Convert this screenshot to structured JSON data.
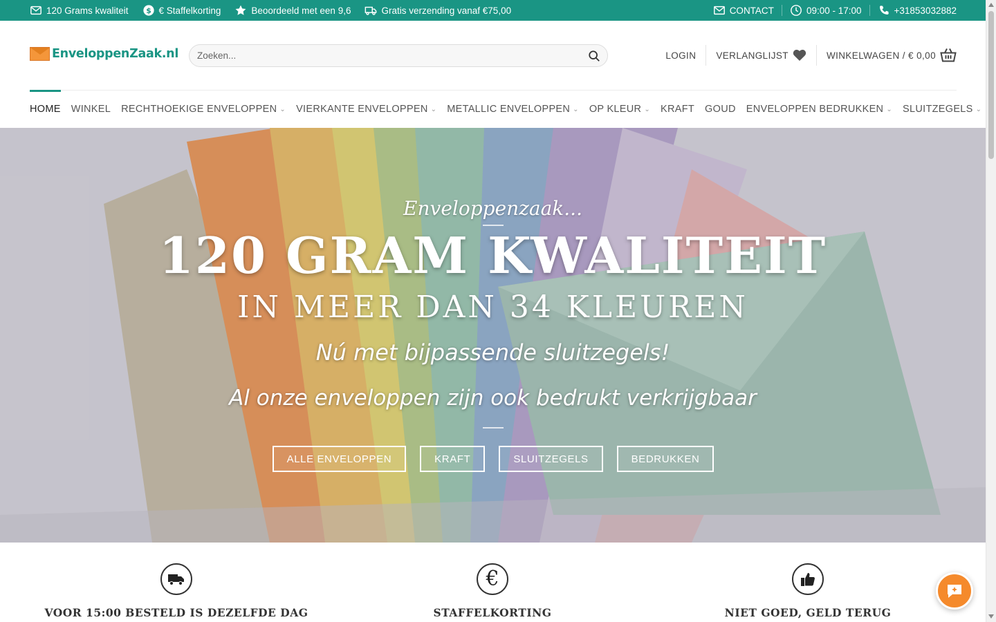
{
  "topbar": {
    "usps": [
      {
        "icon": "mail-icon",
        "label": "120 Grams kwaliteit"
      },
      {
        "icon": "dollar-icon",
        "label": "€ Staffelkorting"
      },
      {
        "icon": "star-icon",
        "label": "Beoordeeld met een 9,6"
      },
      {
        "icon": "truck-icon",
        "label": "Gratis verzending vanaf €75,00"
      }
    ],
    "contact_label": "CONTACT",
    "hours": "09:00 - 17:00",
    "phone": "+31853032882"
  },
  "header": {
    "logo_text": "EnveloppenZaak.nl",
    "search_placeholder": "Zoeken...",
    "login_label": "LOGIN",
    "wishlist_label": "VERLANGLIJST",
    "cart_label": "WINKELWAGEN / € 0,00"
  },
  "nav": {
    "items": [
      {
        "label": "HOME",
        "dropdown": false,
        "active": true
      },
      {
        "label": "WINKEL",
        "dropdown": false
      },
      {
        "label": "RECHTHOEKIGE ENVELOPPEN",
        "dropdown": true
      },
      {
        "label": "VIERKANTE ENVELOPPEN",
        "dropdown": true
      },
      {
        "label": "METALLIC ENVELOPPEN",
        "dropdown": true
      },
      {
        "label": "OP KLEUR",
        "dropdown": true
      },
      {
        "label": "KRAFT",
        "dropdown": false
      },
      {
        "label": "GOUD",
        "dropdown": false
      },
      {
        "label": "ENVELOPPEN BEDRUKKEN",
        "dropdown": true
      },
      {
        "label": "SLUITZEGELS",
        "dropdown": true
      }
    ]
  },
  "hero": {
    "kicker": "Enveloppenzaak...",
    "headline": "120 GRAM KWALITEIT",
    "subheadline": "IN MEER DAN 34 KLEUREN",
    "tagline1": "Nú met bijpassende sluitzegels!",
    "tagline2": "Al onze enveloppen zijn ook bedrukt verkrijgbaar",
    "buttons": [
      "ALLE ENVELOPPEN",
      "KRAFT",
      "SLUITZEGELS",
      "BEDRUKKEN"
    ]
  },
  "features": [
    {
      "icon": "truck-icon",
      "title": "VOOR 15:00 BESTELD IS DEZELFDE DAG"
    },
    {
      "icon": "euro-icon",
      "title": "STAFFELKORTING"
    },
    {
      "icon": "thumbs-up-icon",
      "title": "NIET GOED, GELD TERUG"
    }
  ],
  "colors": {
    "brand": "#1a9584",
    "accent": "#f58a2c"
  }
}
